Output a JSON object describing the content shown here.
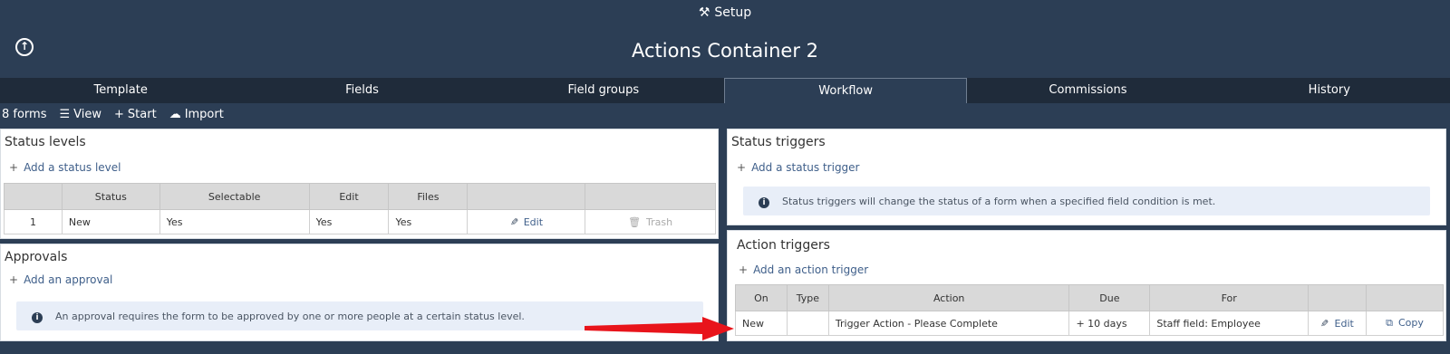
{
  "header": {
    "setup_label": "Setup",
    "title": "Actions Container 2"
  },
  "tabs": [
    "Template",
    "Fields",
    "Field groups",
    "Workflow",
    "Commissions",
    "History"
  ],
  "active_tab": "Workflow",
  "subbar": {
    "forms_count": "8 forms",
    "view": "View",
    "start": "Start",
    "import": "Import"
  },
  "status_levels": {
    "title": "Status levels",
    "add_label": "Add a status level",
    "columns": [
      "",
      "Status",
      "Selectable",
      "Edit",
      "Files",
      "",
      ""
    ],
    "rows": [
      {
        "num": "1",
        "status": "New",
        "selectable": "Yes",
        "edit": "Yes",
        "files": "Yes",
        "edit_action": "Edit",
        "trash_action": "Trash"
      }
    ]
  },
  "approvals": {
    "title": "Approvals",
    "add_label": "Add an approval",
    "info": "An approval requires the form to be approved by one or more people at a certain status level."
  },
  "status_triggers": {
    "title": "Status triggers",
    "add_label": "Add a status trigger",
    "info": "Status triggers will change the status of a form when a specified field condition is met."
  },
  "action_triggers": {
    "title": "Action triggers",
    "add_label": "Add an action trigger",
    "columns": [
      "On",
      "Type",
      "Action",
      "Due",
      "For",
      "",
      ""
    ],
    "rows": [
      {
        "on": "New",
        "type": "",
        "action": "Trigger Action - Please Complete",
        "due": "+ 10 days",
        "for": "Staff field: Employee",
        "edit_action": "Edit",
        "copy_action": "Copy"
      }
    ]
  },
  "colors": {
    "header_bg": "#2c3e55",
    "tab_bar_bg": "#1f2b3a",
    "link": "#3f5f8a",
    "arrow": "#e8141b"
  }
}
